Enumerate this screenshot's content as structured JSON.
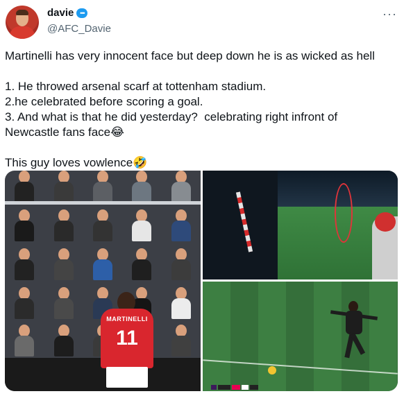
{
  "author": {
    "display_name": "davie",
    "handle": "@AFC_Davie"
  },
  "menu": {
    "more_label": "···"
  },
  "tweet": {
    "line1": "Martinelli has very innocent face but deep down he is as wicked as hell",
    "line2": "1. He throwed arsenal scarf at tottenham stadium.",
    "line3": "2.he celebrated before scoring a goal.",
    "line4": "3. And what is that he did yesterday?  celebrating right infront of",
    "line5": "Newcastle fans face😂",
    "line6": "This guy loves vowlence🤣"
  },
  "media": {
    "player_shirt_name": "MARTINELLI",
    "player_shirt_number": "11"
  },
  "colors": {
    "accent": "#1d9bf0",
    "text": "#0f1419",
    "secondary_text": "#536471",
    "arsenal_red": "#d9262e"
  }
}
